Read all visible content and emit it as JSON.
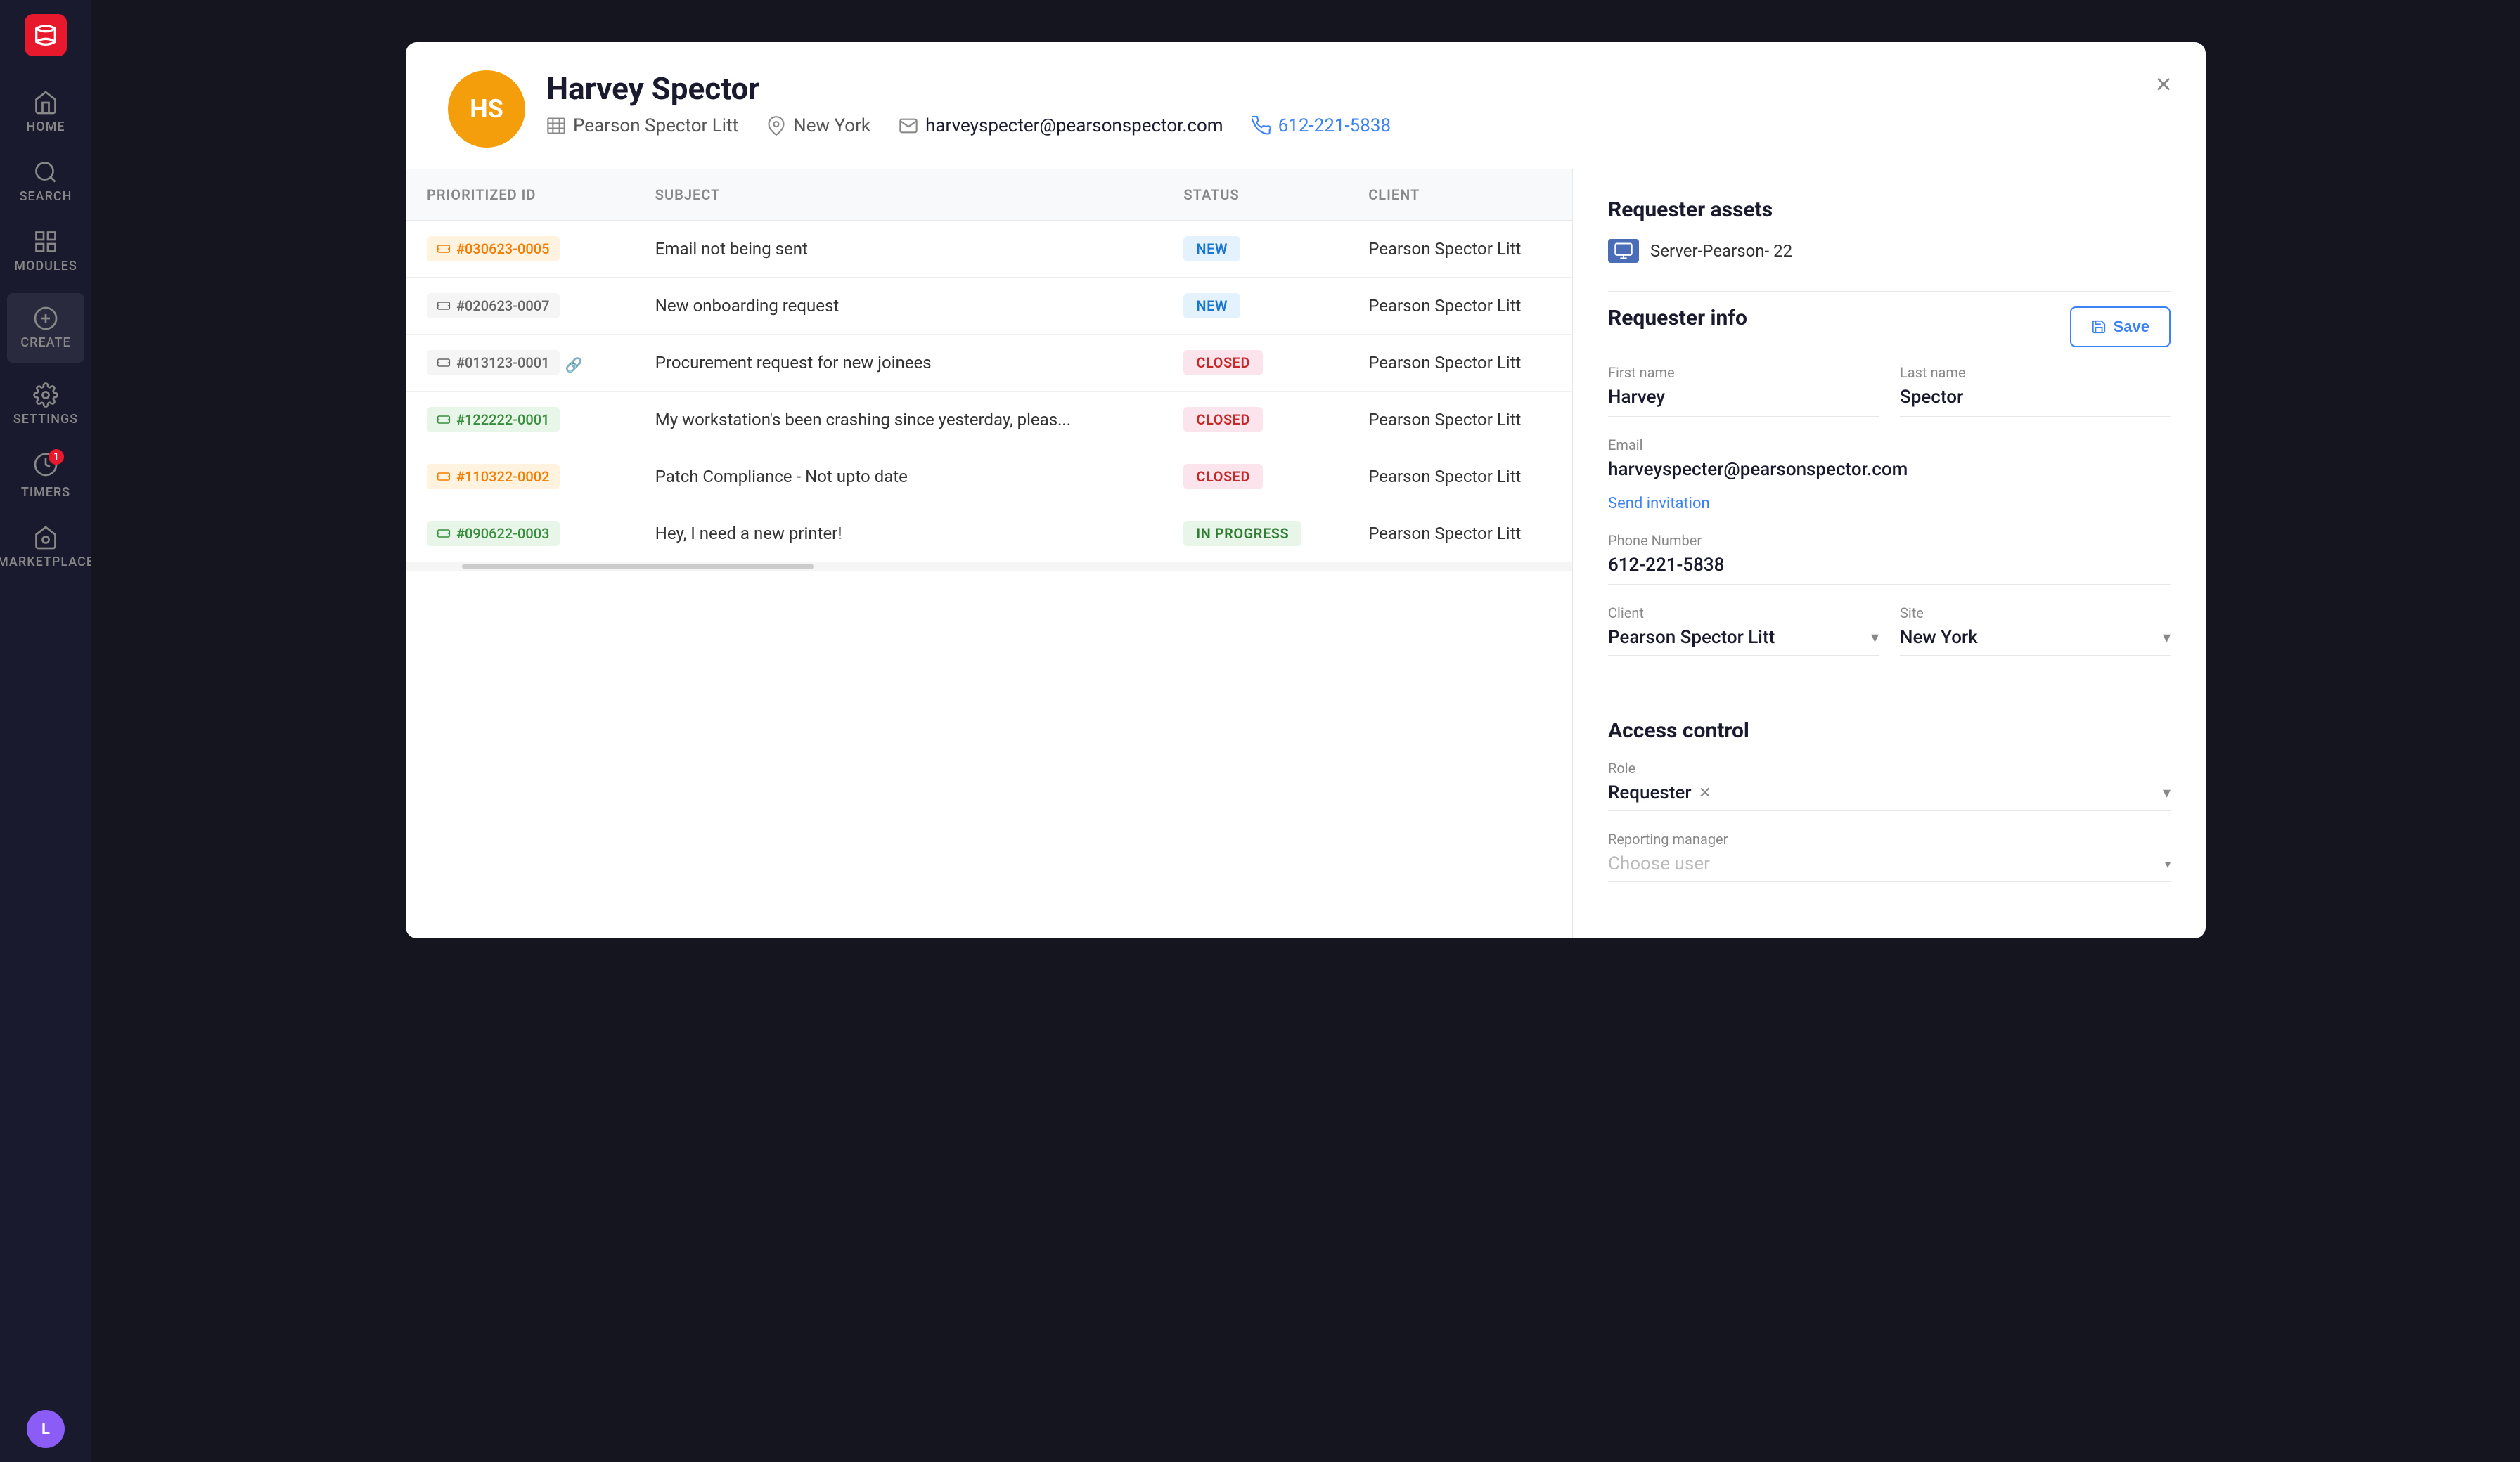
{
  "sidebar": {
    "logo": "S",
    "items": [
      {
        "id": "home",
        "label": "HOME",
        "icon": "home"
      },
      {
        "id": "search",
        "label": "SEARCH",
        "icon": "search"
      },
      {
        "id": "modules",
        "label": "MODULES",
        "icon": "modules"
      },
      {
        "id": "create",
        "label": "CREATE",
        "icon": "create"
      },
      {
        "id": "settings",
        "label": "SETTINGS",
        "icon": "settings"
      },
      {
        "id": "timers",
        "label": "TIMERS",
        "icon": "timers",
        "badge": "1"
      },
      {
        "id": "marketplace",
        "label": "MARKETPLACE",
        "icon": "marketplace"
      }
    ],
    "avatar": {
      "initials": "L",
      "color": "#8b5cf6"
    }
  },
  "modal": {
    "user": {
      "initials": "HS",
      "avatar_color": "#f59e0b",
      "name": "Harvey Spector",
      "company": "Pearson Spector Litt",
      "location": "New York",
      "email": "harveyspecter@pearsonspector.com",
      "phone": "612-221-5838"
    },
    "close_label": "×",
    "tickets_table": {
      "columns": [
        "PRIORITIZED ID",
        "SUBJECT",
        "STATUS",
        "CLIENT"
      ],
      "rows": [
        {
          "id": "#030623-0005",
          "badge_type": "orange",
          "icon": "ticket",
          "subject": "Email not being sent",
          "status": "NEW",
          "status_type": "new",
          "client": "Pearson Spector Litt"
        },
        {
          "id": "#020623-0007",
          "badge_type": "gray",
          "icon": "ticket",
          "subject": "New onboarding request",
          "status": "NEW",
          "status_type": "new",
          "client": "Pearson Spector Litt"
        },
        {
          "id": "#013123-0001",
          "badge_type": "gray",
          "icon": "ticket",
          "has_link": true,
          "subject": "Procurement request for new joinees",
          "status": "CLOSED",
          "status_type": "closed",
          "client": "Pearson Spector Litt"
        },
        {
          "id": "#122222-0001",
          "badge_type": "green",
          "icon": "ticket",
          "subject": "My workstation's been crashing since yesterday, pleas...",
          "status": "CLOSED",
          "status_type": "closed",
          "client": "Pearson Spector Litt"
        },
        {
          "id": "#110322-0002",
          "badge_type": "orange",
          "icon": "ticket",
          "subject": "Patch Compliance - Not upto date",
          "status": "CLOSED",
          "status_type": "closed",
          "client": "Pearson Spector Litt"
        },
        {
          "id": "#090622-0003",
          "badge_type": "green",
          "icon": "ticket",
          "subject": "Hey, I need a new printer!",
          "status": "IN PROGRESS",
          "status_type": "inprogress",
          "client": "Pearson Spector Litt"
        }
      ]
    },
    "right_panel": {
      "requester_assets_title": "Requester assets",
      "asset": {
        "name": "Server-Pearson- 22",
        "icon": "monitor"
      },
      "requester_info_title": "Requester info",
      "save_label": "Save",
      "fields": {
        "first_name_label": "First name",
        "first_name": "Harvey",
        "last_name_label": "Last name",
        "last_name": "Spector",
        "email_label": "Email",
        "email": "harveyspecter@pearsonspector.com",
        "send_invitation_label": "Send invitation",
        "phone_label": "Phone Number",
        "phone": "612-221-5838",
        "client_label": "Client",
        "client": "Pearson Spector Litt",
        "site_label": "Site",
        "site": "New York"
      },
      "access_control_title": "Access control",
      "role_label": "Role",
      "role_value": "Requester",
      "reporting_manager_label": "Reporting manager",
      "choose_user_placeholder": "Choose user"
    }
  }
}
